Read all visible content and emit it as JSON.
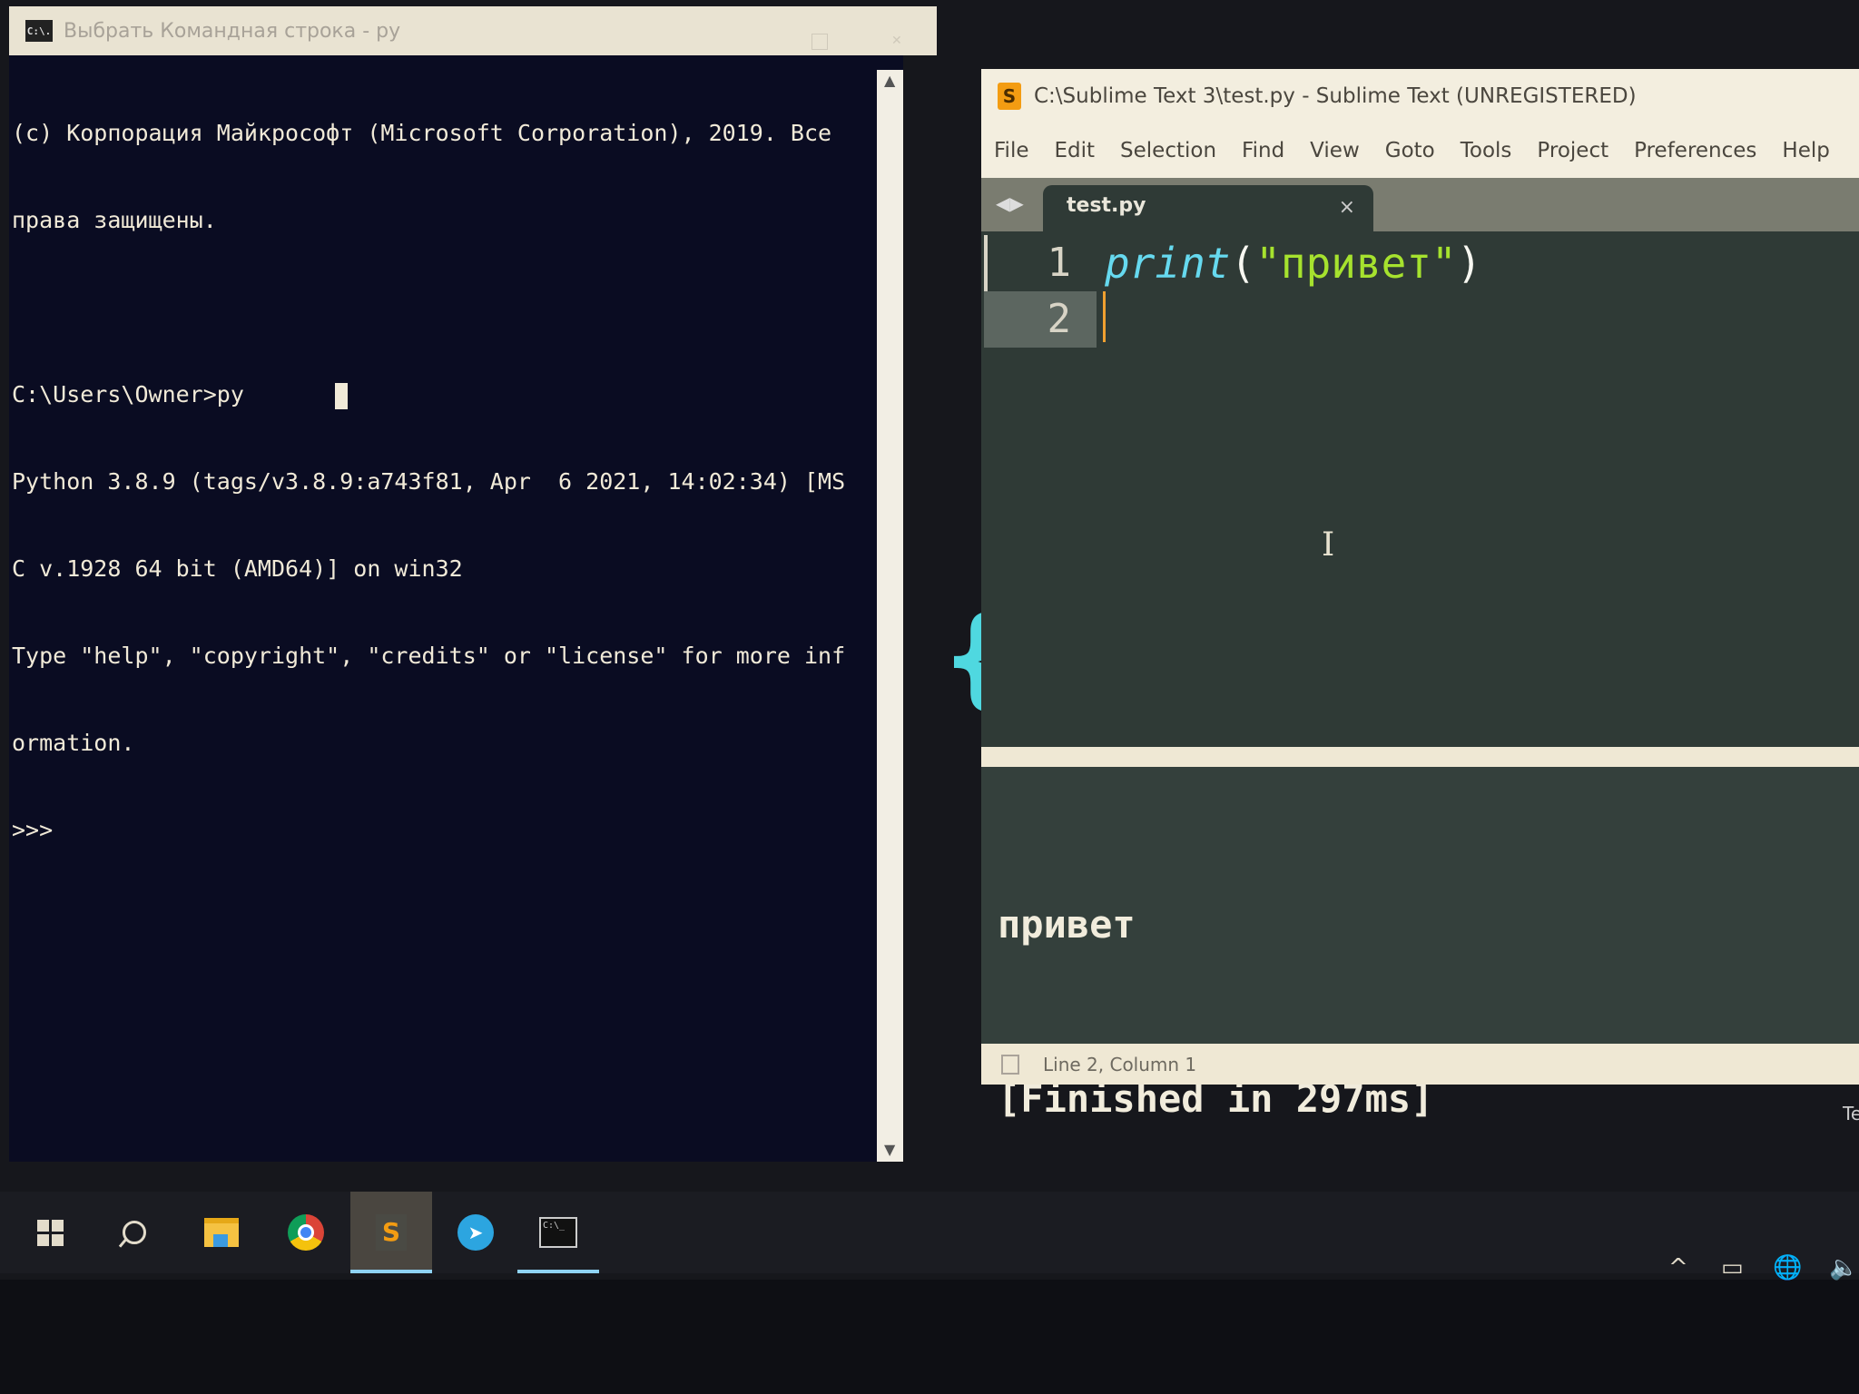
{
  "cmd": {
    "icon": "C:\\.",
    "title": "Выбрать Командная строка - py",
    "lines": [
      "(c) Корпорация Майкрософт (Microsoft Corporation), 2019. Все",
      "права защищены.",
      "",
      "C:\\Users\\Owner>py",
      "Python 3.8.9 (tags/v3.8.9:a743f81, Apr  6 2021, 14:02:34) [MS",
      "C v.1928 64 bit (AMD64)] on win32",
      "Type \"help\", \"copyright\", \"credits\" or \"license\" for more inf",
      "ormation.",
      ">>>"
    ]
  },
  "sublime": {
    "title": "C:\\Sublime Text 3\\test.py - Sublime Text (UNREGISTERED)",
    "menu": [
      "File",
      "Edit",
      "Selection",
      "Find",
      "View",
      "Goto",
      "Tools",
      "Project",
      "Preferences",
      "Help"
    ],
    "tab": {
      "label": "test.py",
      "close": "×"
    },
    "gutter": [
      "1",
      "2"
    ],
    "code": {
      "fn": "print",
      "open": "(",
      "string": "\"привет\"",
      "close": ")"
    },
    "output": [
      "привет",
      "[Finished in 297ms]"
    ],
    "status": "Line 2, Column 1"
  },
  "desktop_label": "Te",
  "taskbar": {
    "items": [
      "start",
      "search",
      "file-explorer",
      "chrome",
      "sublime-text",
      "telegram",
      "command-prompt"
    ],
    "active": [
      "sublime-text",
      "command-prompt"
    ]
  },
  "colors": {
    "cmd_bg": "#0a0c22",
    "editor_bg": "#2f3a36",
    "string": "#a6e22e",
    "function": "#66d9ef",
    "caret": "#f0a030"
  }
}
